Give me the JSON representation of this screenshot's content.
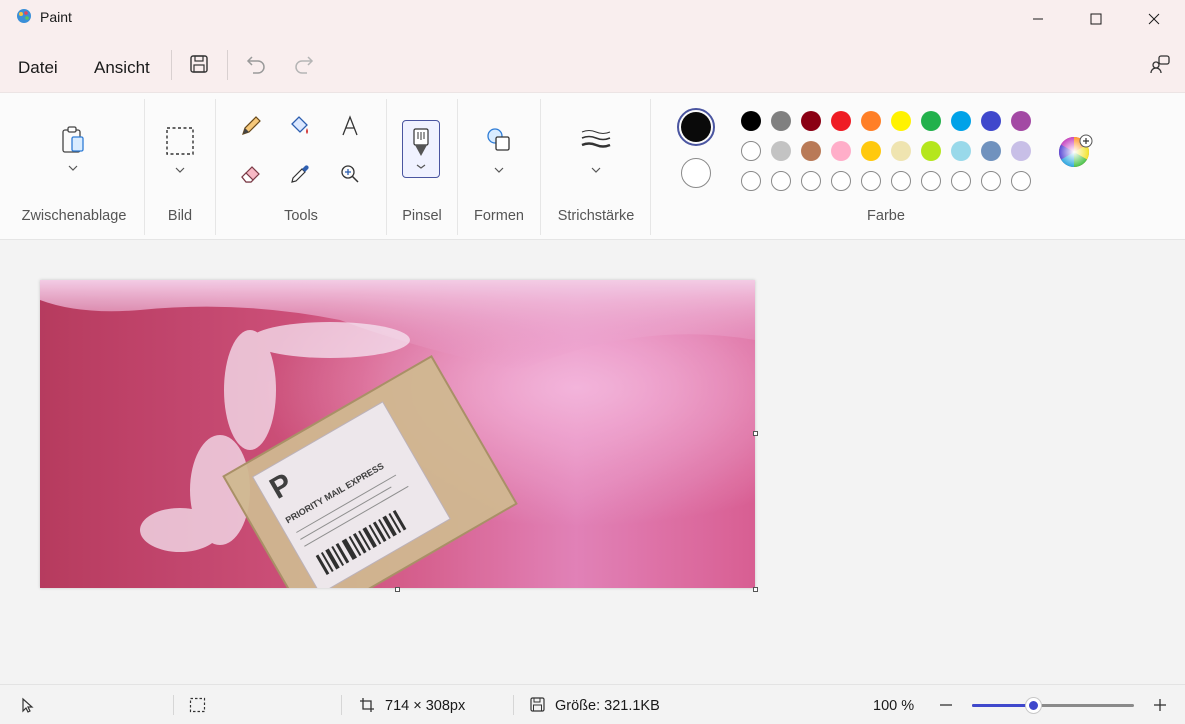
{
  "window": {
    "title": "Paint"
  },
  "menu": {
    "file": "Datei",
    "view": "Ansicht"
  },
  "ribbon": {
    "clipboard_label": "Zwischenablage",
    "image_label": "Bild",
    "tools_label": "Tools",
    "brush_label": "Pinsel",
    "shapes_label": "Formen",
    "stroke_label": "Strichstärke",
    "color_label": "Farbe"
  },
  "colors": {
    "primary": "#0a0a0a",
    "secondary": "#ffffff",
    "row1": [
      "#000000",
      "#808080",
      "#8b0014",
      "#ef1c24",
      "#ff7f27",
      "#fff200",
      "#22b14c",
      "#00a2e8",
      "#3f48cc",
      "#a349a4"
    ],
    "row2": [
      "#ffffff",
      "#c3c3c3",
      "#b97a57",
      "#ffaec9",
      "#ffc90e",
      "#efe4b0",
      "#b5e61d",
      "#99d9ea",
      "#7092be",
      "#c8bfe7"
    ],
    "row3_count": 10
  },
  "image": {
    "label_line1": "PRIORITY MAIL EXPRESS",
    "logo_letter": "P"
  },
  "status": {
    "dimensions": "714 × 308px",
    "size": "Größe: 321.1KB",
    "zoom": "100 %",
    "zoom_level": 0.38
  },
  "icons": {
    "app": "paint-app-icon",
    "save": "save-icon",
    "undo": "undo-icon",
    "redo": "redo-icon",
    "share": "share-icon"
  }
}
